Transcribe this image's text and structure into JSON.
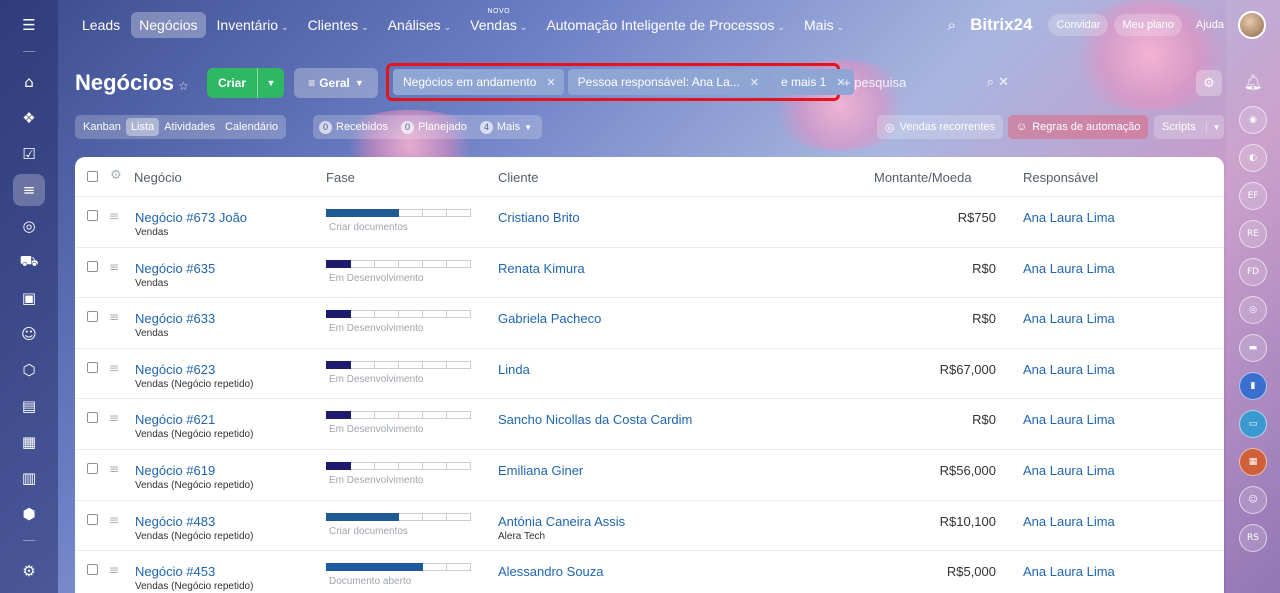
{
  "topnav": {
    "items": [
      {
        "label": "Leads",
        "chevron": false,
        "active": false
      },
      {
        "label": "Negócios",
        "chevron": false,
        "active": true
      },
      {
        "label": "Inventário",
        "chevron": true,
        "active": false
      },
      {
        "label": "Clientes",
        "chevron": true,
        "active": false
      },
      {
        "label": "Análises",
        "chevron": true,
        "active": false
      },
      {
        "label": "Vendas",
        "chevron": true,
        "active": false,
        "badge": "NOVO"
      },
      {
        "label": "Automação Inteligente de Processos",
        "chevron": true,
        "active": false
      },
      {
        "label": "Mais",
        "chevron": true,
        "active": false
      }
    ],
    "logo": "Bitrix24",
    "invite": "Convidar",
    "plan": "Meu plano",
    "help": "Ajuda"
  },
  "page": {
    "title": "Negócios",
    "create_label": "Criar",
    "pipeline_label": "Geral"
  },
  "filters": {
    "chips": [
      {
        "label": "Negócios em andamento"
      },
      {
        "label": "Pessoa responsável: Ana La..."
      },
      {
        "label": "e mais 1"
      }
    ],
    "search_placeholder": "+ pesquisa"
  },
  "views": {
    "items": [
      {
        "label": "Kanban",
        "active": false
      },
      {
        "label": "Lista",
        "active": true
      },
      {
        "label": "Atividades",
        "active": false
      },
      {
        "label": "Calendário",
        "active": false
      }
    ]
  },
  "counters": {
    "received": {
      "count": "0",
      "label": "Recebidos"
    },
    "planned": {
      "count": "0",
      "label": "Planejado"
    },
    "more": {
      "count": "4",
      "label": "Mais"
    }
  },
  "actions": {
    "recurring": "Vendas recorrentes",
    "automation": "Regras de automação",
    "scripts": "Scripts"
  },
  "table": {
    "headers": {
      "deal": "Negócio",
      "stage": "Fase",
      "client": "Cliente",
      "amount": "Montante/Moeda",
      "responsible": "Responsável"
    },
    "rows": [
      {
        "title": "Negócio #673 João",
        "pipeline": "Vendas",
        "stage_filled": 3,
        "stage_color": "#1e5a96",
        "stage": "Criar documentos",
        "client": "Cristiano Brito",
        "client_sub": "",
        "amount": "R$750",
        "responsible": "Ana Laura Lima"
      },
      {
        "title": "Negócio #635",
        "pipeline": "Vendas",
        "stage_filled": 1,
        "stage_color": "#1e1a6e",
        "stage": "Em Desenvolvimento",
        "client": "Renata Kimura",
        "client_sub": "",
        "amount": "R$0",
        "responsible": "Ana Laura Lima"
      },
      {
        "title": "Negócio #633",
        "pipeline": "Vendas",
        "stage_filled": 1,
        "stage_color": "#1e1a6e",
        "stage": "Em Desenvolvimento",
        "client": "Gabriela Pacheco",
        "client_sub": "",
        "amount": "R$0",
        "responsible": "Ana Laura Lima"
      },
      {
        "title": "Negócio #623",
        "pipeline": "Vendas (Negócio repetido)",
        "stage_filled": 1,
        "stage_color": "#1e1a6e",
        "stage": "Em Desenvolvimento",
        "client": "Linda",
        "client_sub": "",
        "amount": "R$67,000",
        "responsible": "Ana Laura Lima"
      },
      {
        "title": "Negócio #621",
        "pipeline": "Vendas (Negócio repetido)",
        "stage_filled": 1,
        "stage_color": "#1e1a6e",
        "stage": "Em Desenvolvimento",
        "client": "Sancho Nicollas da Costa Cardim",
        "client_sub": "",
        "amount": "R$0",
        "responsible": "Ana Laura Lima"
      },
      {
        "title": "Negócio #619",
        "pipeline": "Vendas (Negócio repetido)",
        "stage_filled": 1,
        "stage_color": "#1e1a6e",
        "stage": "Em Desenvolvimento",
        "client": "Emiliana Giner",
        "client_sub": "",
        "amount": "R$56,000",
        "responsible": "Ana Laura Lima"
      },
      {
        "title": "Negócio #483",
        "pipeline": "Vendas (Negócio repetido)",
        "stage_filled": 3,
        "stage_color": "#1e5a96",
        "stage": "Criar documentos",
        "client": "Antónia Caneira Assis",
        "client_sub": "Alera Tech",
        "amount": "R$10,100",
        "responsible": "Ana Laura Lima"
      },
      {
        "title": "Negócio #453",
        "pipeline": "Vendas (Negócio repetido)",
        "stage_filled": 4,
        "stage_color": "#1e5aa0",
        "stage": "Documento aberto",
        "client": "Alessandro Souza",
        "client_sub": "",
        "amount": "R$5,000",
        "responsible": "Ana Laura Lima"
      }
    ]
  },
  "right_rail": {
    "avatars": [
      "EF",
      "RE",
      "FD",
      "RS"
    ]
  },
  "colors": {
    "create_button": "#2fb863",
    "link": "#2066b0",
    "filter_highlight": "#e2141c"
  }
}
